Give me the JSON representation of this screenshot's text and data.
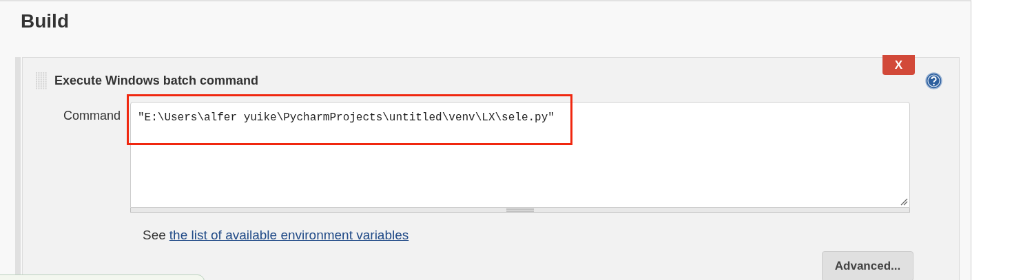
{
  "section_title": "Build",
  "step": {
    "title": "Execute Windows batch command",
    "delete_label": "X",
    "command_label": "Command",
    "command_value": "\"E:\\Users\\alfer yuike\\PycharmProjects\\untitled\\venv\\LX\\sele.py\"",
    "highlighted": true,
    "see_text": "See",
    "see_link": "the list of available environment variables",
    "advanced_label": "Advanced..."
  }
}
